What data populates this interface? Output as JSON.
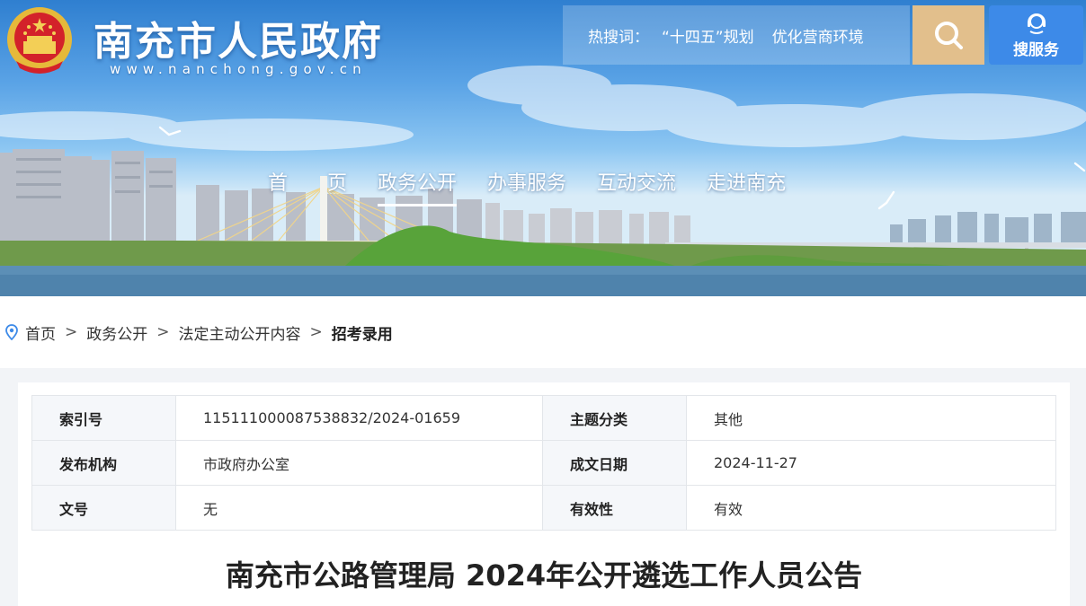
{
  "header": {
    "site_title": "南充市人民政府",
    "site_url": "www.nanchong.gov.cn",
    "hotwords_label": "热搜词：",
    "hotwords": [
      "“十四五”规划",
      "优化营商环境"
    ],
    "service_label": "搜服务",
    "colors": {
      "search_bg": "#e2bf8c",
      "service_bg": "#3d8ae8"
    }
  },
  "nav": {
    "items": [
      "首页",
      "政务公开",
      "办事服务",
      "互动交流",
      "走进南充"
    ],
    "active": "政务公开"
  },
  "breadcrumb": {
    "items": [
      "首页",
      "政务公开",
      "法定主动公开内容"
    ],
    "separator": ">",
    "current": "招考录用"
  },
  "meta": {
    "rows": [
      {
        "k1": "索引号",
        "v1": "115111000087538832/2024-01659",
        "k2": "主题分类",
        "v2": "其他"
      },
      {
        "k1": "发布机构",
        "v1": "市政府办公室",
        "k2": "成文日期",
        "v2": "2024-11-27"
      },
      {
        "k1": "文号",
        "v1": "无",
        "k2": "有效性",
        "v2": "有效"
      }
    ]
  },
  "article": {
    "title": "南充市公路管理局 2024年公开遴选工作人员公告"
  }
}
